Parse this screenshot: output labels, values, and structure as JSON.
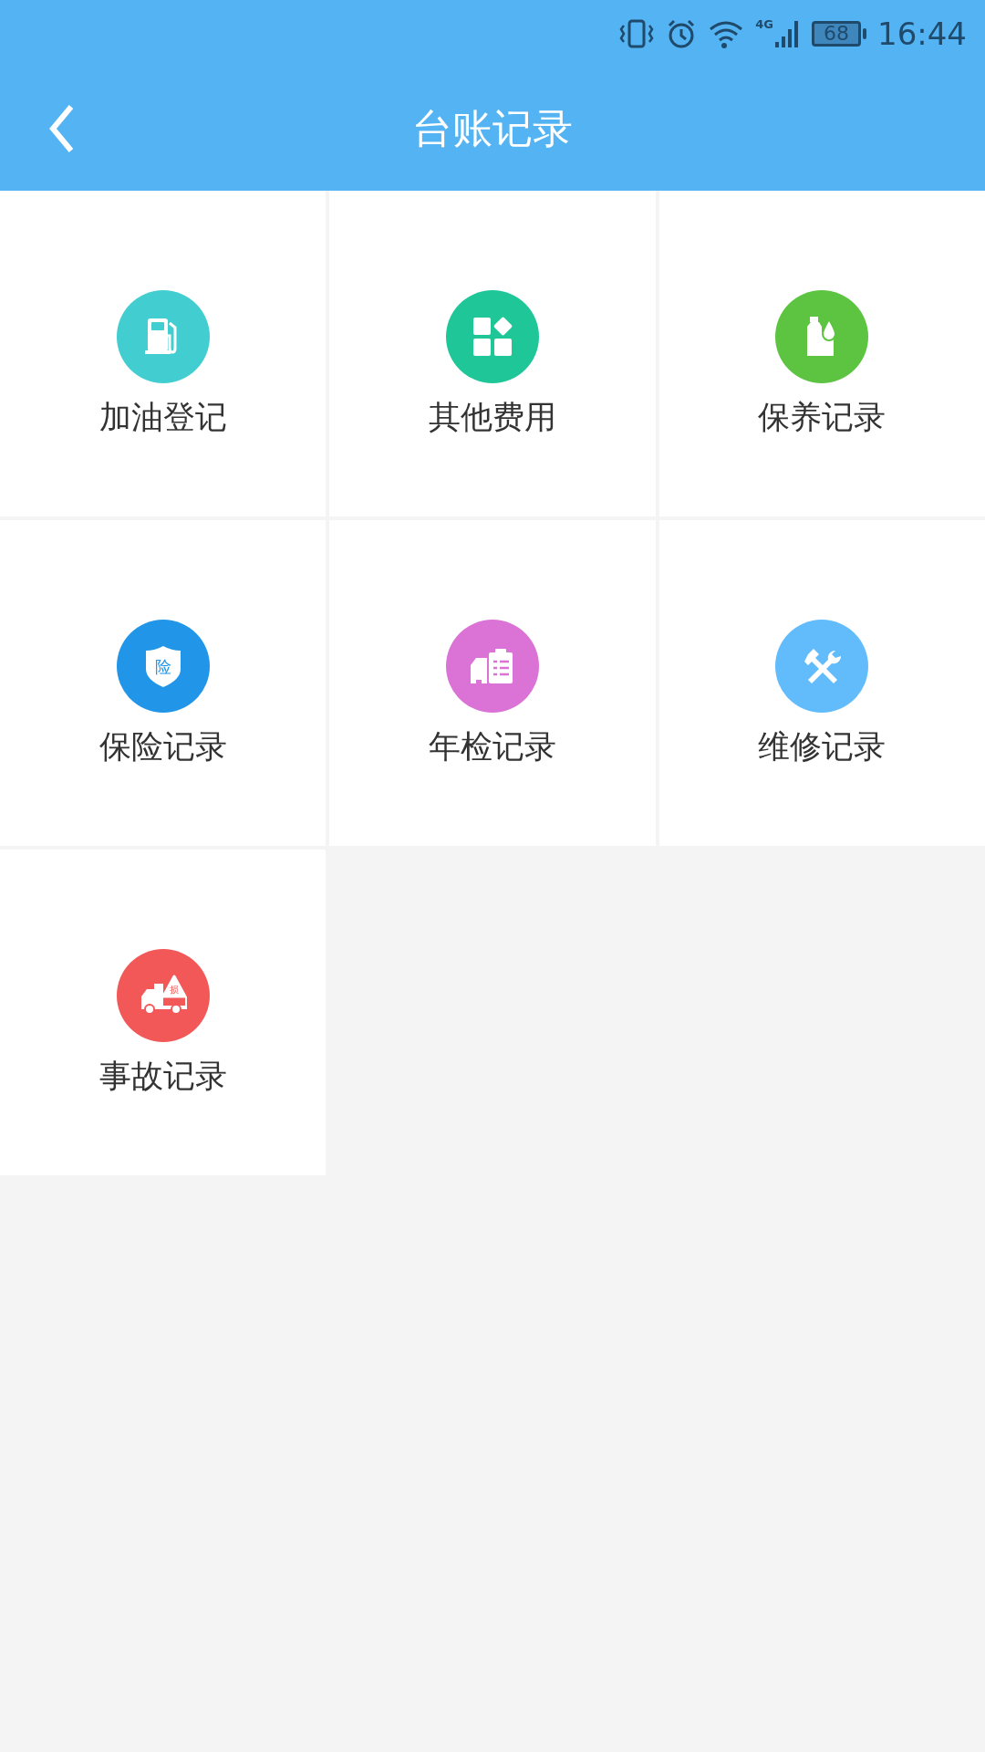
{
  "status_bar": {
    "network": "4G",
    "battery": "68",
    "time": "16:44"
  },
  "header": {
    "title": "台账记录"
  },
  "items": [
    {
      "kind": "fuel",
      "label": "加油登记",
      "color": "#42cdd0"
    },
    {
      "kind": "other",
      "label": "其他费用",
      "color": "#1fc698"
    },
    {
      "kind": "maintenance",
      "label": "保养记录",
      "color": "#5cc440"
    },
    {
      "kind": "insurance",
      "label": "保险记录",
      "color": "#2196e8",
      "icon_text": "险"
    },
    {
      "kind": "inspection",
      "label": "年检记录",
      "color": "#db72d6"
    },
    {
      "kind": "repair",
      "label": "维修记录",
      "color": "#62bcfc"
    },
    {
      "kind": "accident",
      "label": "事故记录",
      "color": "#f25858",
      "icon_text": "损"
    }
  ]
}
